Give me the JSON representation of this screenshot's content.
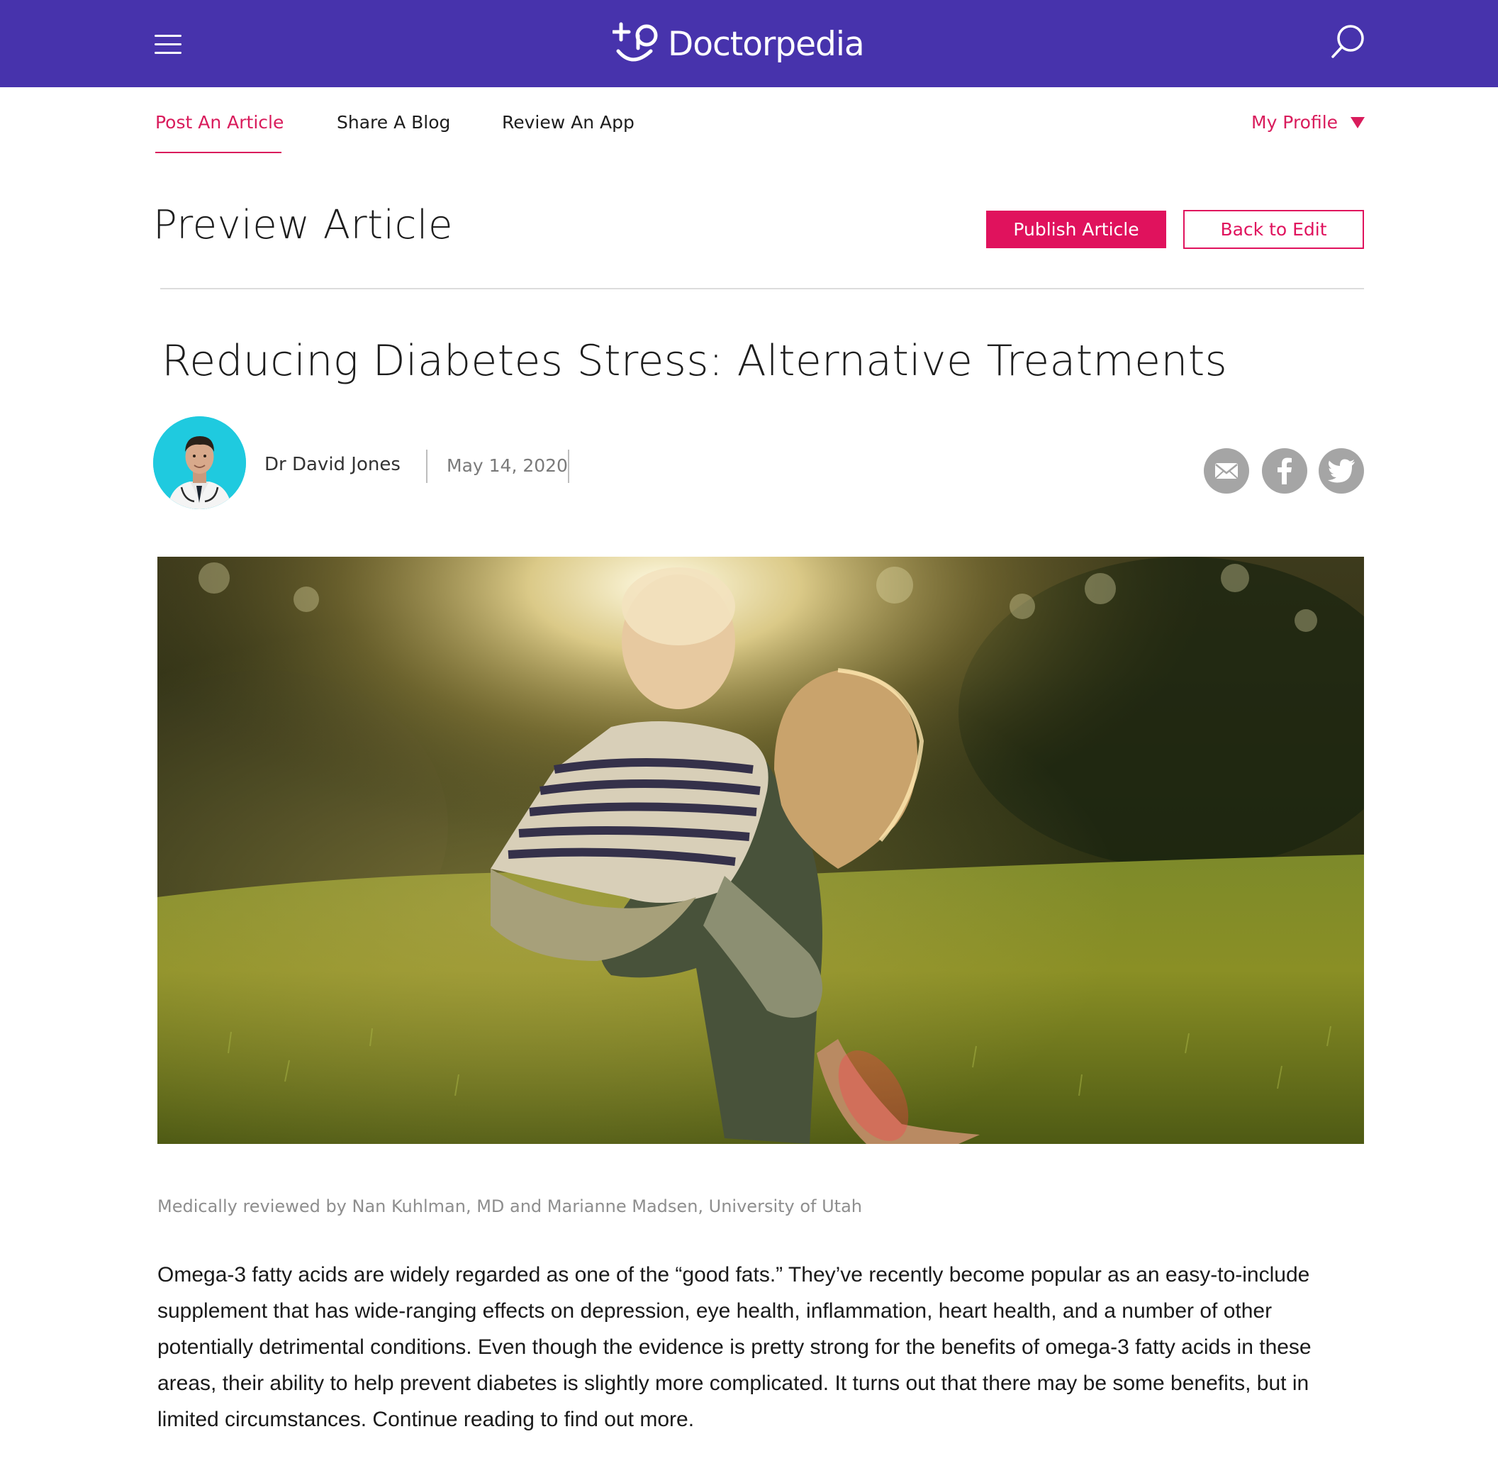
{
  "header": {
    "brand": "Doctorpedia",
    "menu_icon": "hamburger-menu-icon",
    "search_icon": "search-icon",
    "bg_color": "#4733ac"
  },
  "nav": {
    "items": [
      {
        "label": "Post An Article",
        "active": true
      },
      {
        "label": "Share A Blog",
        "active": false
      },
      {
        "label": "Review An App",
        "active": false
      }
    ],
    "profile_label": "My Profile",
    "accent_color": "#d91c5c"
  },
  "preview": {
    "title": "Preview Article",
    "publish_label": "Publish Article",
    "back_label": "Back to Edit"
  },
  "article": {
    "title": "Reducing Diabetes Stress:  Alternative Treatments",
    "author": "Dr David Jones",
    "date": "May 14, 2020",
    "share_icons": [
      "email-icon",
      "facebook-icon",
      "twitter-icon"
    ],
    "reviewed_by": "Medically reviewed by Nan Kuhlman, MD and Marianne Madsen, University of Utah",
    "body": "Omega-3 fatty acids are widely regarded as one of the “good fats.” They’ve recently become popular as an easy-to-include supplement that has wide-ranging effects on depression, eye health, inflammation, heart health, and a number of other potentially detrimental conditions. Even though the evidence is pretty strong for the benefits of omega-3 fatty acids in these areas, their ability to help prevent diabetes is slightly more complicated. It turns out that there may be some benefits, but in limited circumstances. Continue reading to find out more."
  }
}
